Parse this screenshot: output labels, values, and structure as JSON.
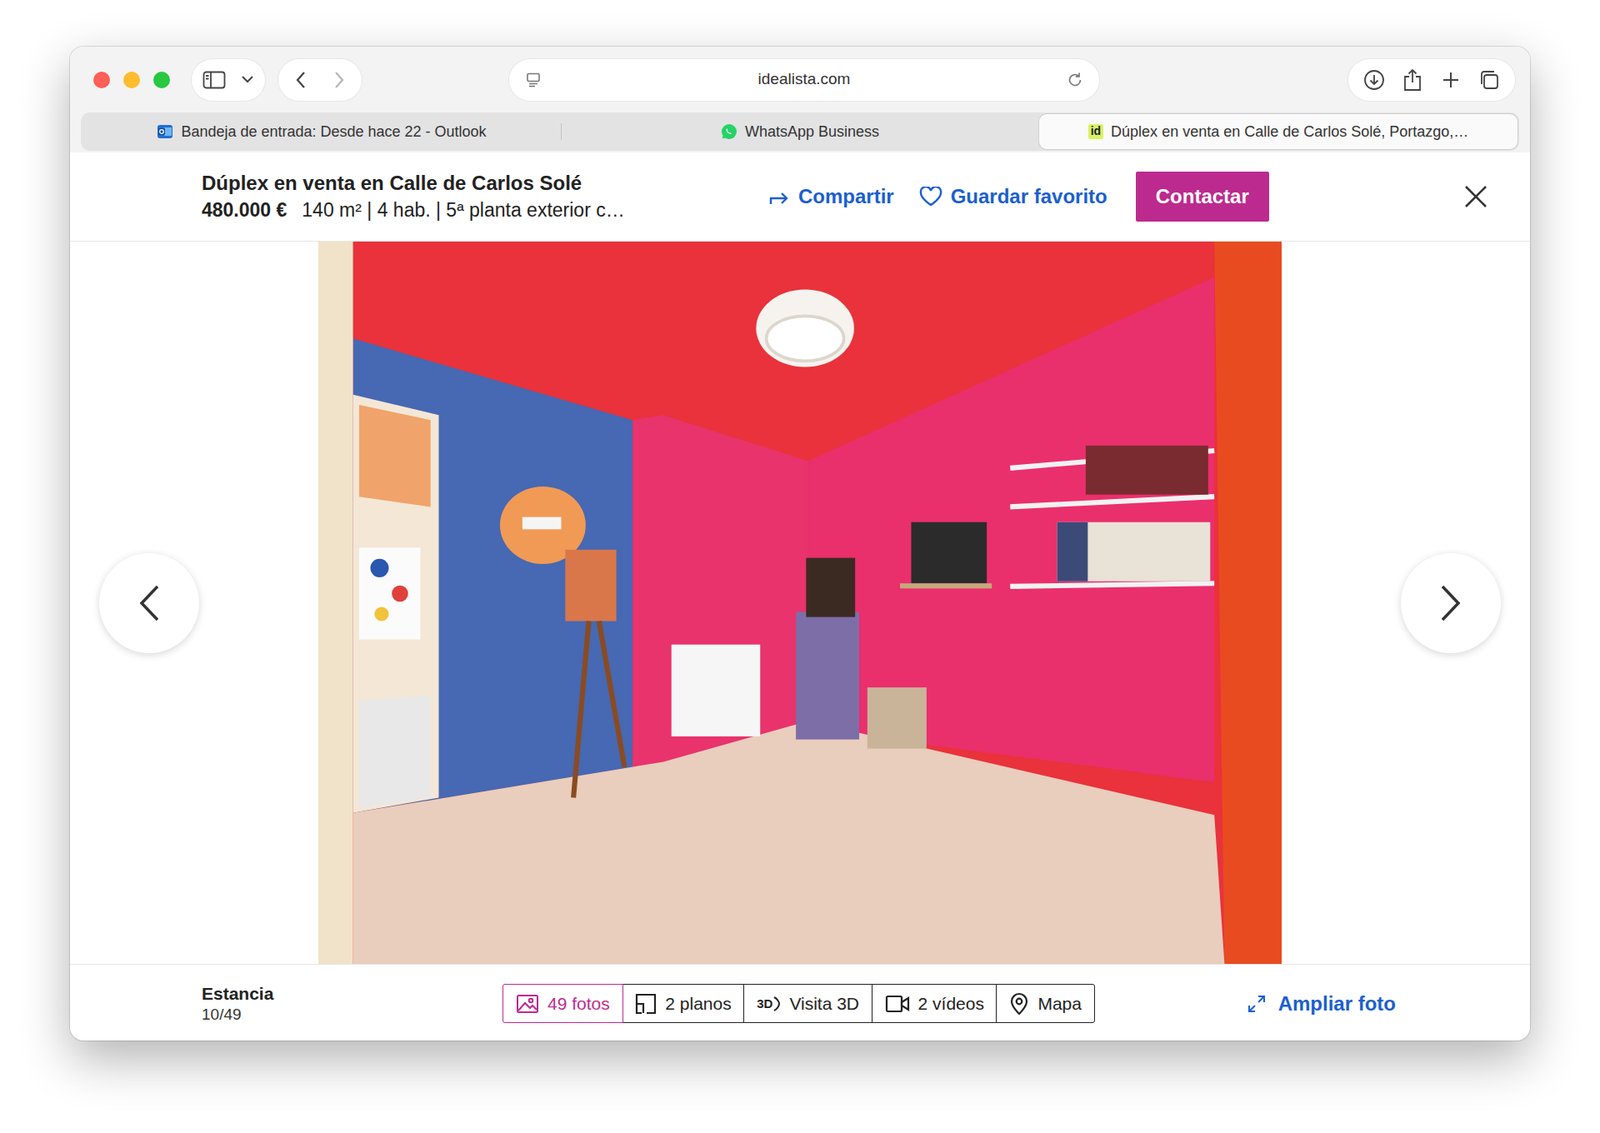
{
  "window": {
    "address": "idealista.com",
    "back_enabled": true,
    "forward_enabled": false
  },
  "tabs": [
    {
      "label": "Bandeja de entrada: Desde hace 22 - Outlook",
      "kind": "outlook",
      "selected": false
    },
    {
      "label": "WhatsApp Business",
      "kind": "whatsapp",
      "selected": false
    },
    {
      "label": "Dúplex en venta en Calle de Carlos Solé, Portazgo,…",
      "kind": "idealista",
      "icon_text": "id",
      "selected": true
    }
  ],
  "listing": {
    "title": "Dúplex en venta en Calle de Carlos Solé",
    "price": "480.000 €",
    "details": "140 m² | 4 hab. | 5ª planta exterior c…",
    "actions": [
      {
        "label": "Compartir",
        "kind": "share"
      },
      {
        "label": "Guardar favorito",
        "kind": "favorite"
      }
    ],
    "contact": "Contactar"
  },
  "viewer": {
    "caption": "Estancia",
    "counter": "10/49",
    "media": [
      {
        "label": "49 fotos",
        "kind": "photos",
        "selected": true
      },
      {
        "label": "2 planos",
        "kind": "plans",
        "selected": false
      },
      {
        "label": "Visita 3D",
        "kind": "tour3d",
        "icon_text": "3D",
        "selected": false
      },
      {
        "label": "2 vídeos",
        "kind": "videos",
        "selected": false
      },
      {
        "label": "Mapa",
        "kind": "map",
        "selected": false
      }
    ],
    "enlarge": "Ampliar foto"
  }
}
